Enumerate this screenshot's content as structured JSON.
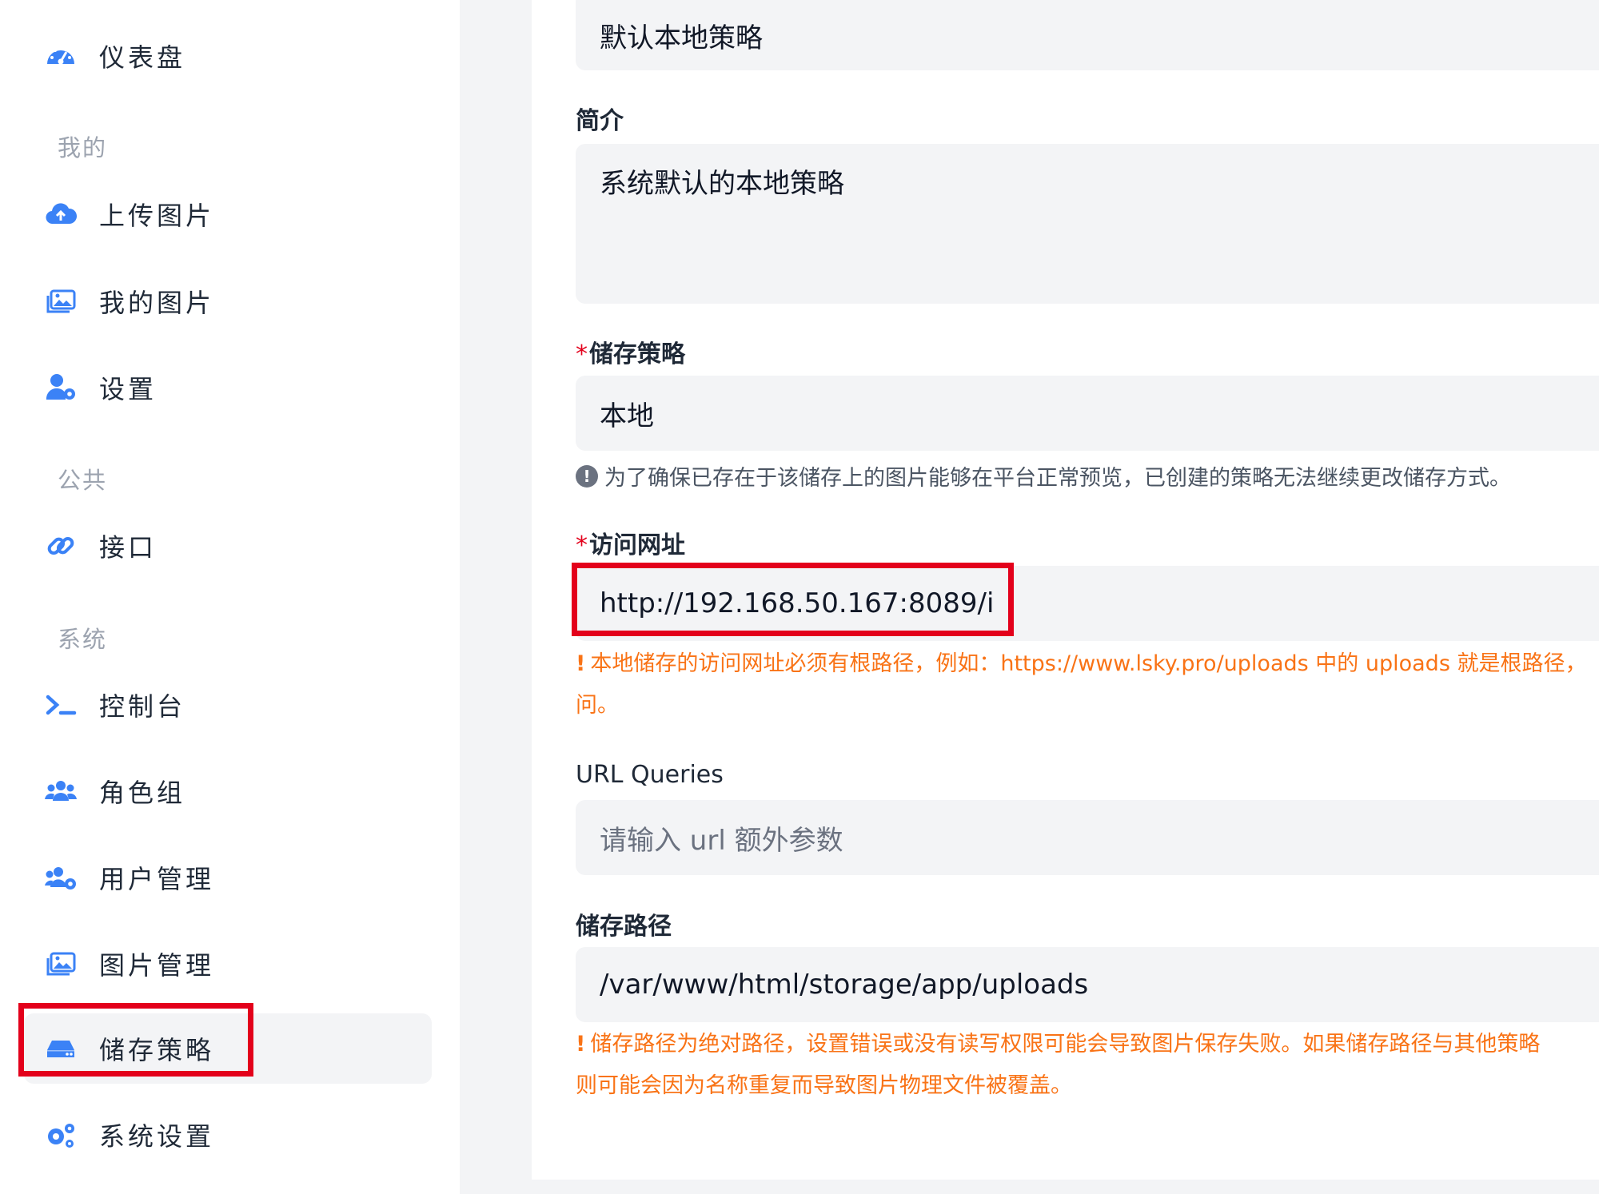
{
  "sidebar": {
    "dashboard": "仪表盘",
    "section_mine": "我的",
    "upload": "上传图片",
    "my_images": "我的图片",
    "settings": "设置",
    "section_public": "公共",
    "api": "接口",
    "section_system": "系统",
    "console": "控制台",
    "role_groups": "角色组",
    "user_management": "用户管理",
    "image_management": "图片管理",
    "storage_strategy": "储存策略",
    "system_settings": "系统设置"
  },
  "form": {
    "name_value": "默认本地策略",
    "intro_label": "简介",
    "intro_value": "系统默认的本地策略",
    "strategy_required": "*",
    "strategy_label": "储存策略",
    "strategy_value": "本地",
    "strategy_hint": "为了确保已存在于该储存上的图片能够在平台正常预览，已创建的策略无法继续更改储存方式。",
    "url_required": "*",
    "url_label": "访问网址",
    "url_value": "http://192.168.50.167:8089/i",
    "url_hint": "本地储存的访问网址必须有根路径，例如：https://www.lsky.pro/uploads 中的 uploads 就是根路径，",
    "url_hint_cont": "问。",
    "queries_label": "URL Queries",
    "queries_placeholder": "请输入 url 额外参数",
    "path_label": "储存路径",
    "path_value": "/var/www/html/storage/app/uploads",
    "path_hint": "储存路径为绝对路径，设置错误或没有读写权限可能会导致图片保存失败。如果储存路径与其他策略",
    "path_hint_cont": "则可能会因为名称重复而导致图片物理文件被覆盖。",
    "hint_bang": "!",
    "info_glyph": "!"
  },
  "colors": {
    "accent_blue": "#3b82f6",
    "highlight_red": "#e3001b",
    "warning_orange": "#f97316"
  },
  "icons": {
    "dashboard": "speedometer-icon",
    "upload": "cloud-upload-icon",
    "my_images": "images-icon",
    "settings": "user-gear-icon",
    "api": "link-icon",
    "console": "terminal-icon",
    "role_groups": "users-icon",
    "user_management": "users-gear-icon",
    "image_management": "images-icon",
    "storage_strategy": "hard-drive-icon",
    "system_settings": "gears-icon"
  }
}
